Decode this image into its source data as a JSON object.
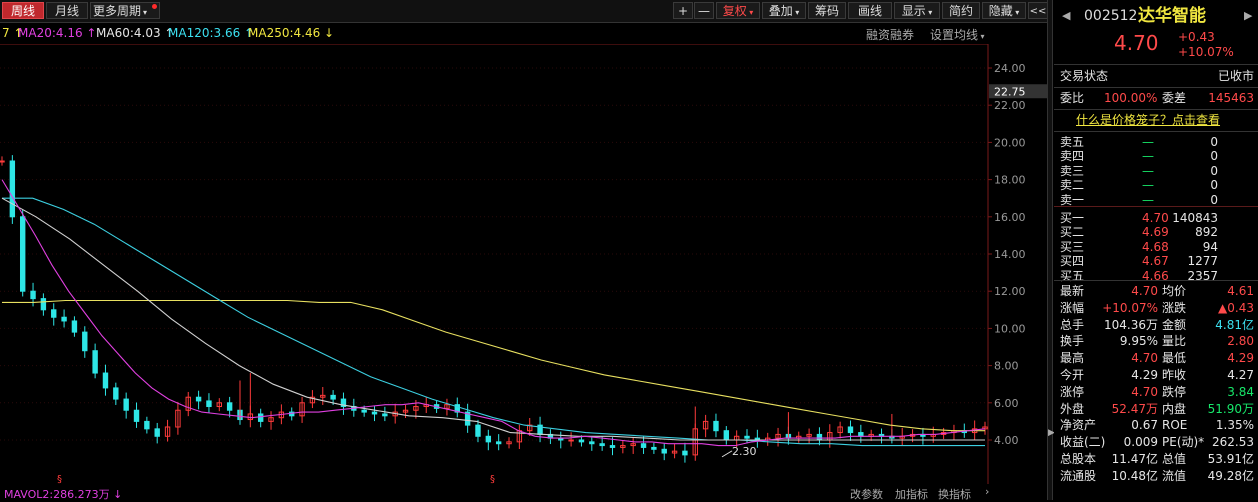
{
  "toolbar": {
    "tabs": [
      {
        "label": "周线",
        "active": true
      },
      {
        "label": "月线",
        "active": false
      },
      {
        "label": "更多周期",
        "active": false
      }
    ],
    "buttons": [
      "+",
      "—",
      "复权",
      "叠加",
      "筹码",
      "画线",
      "显示",
      "简约",
      "隐藏"
    ],
    "collapse": "<<"
  },
  "ma_legend": [
    {
      "label": "7 ↑",
      "color": "#f0e640"
    },
    {
      "label": "MA20:4.16 ↑",
      "color": "#e040e0"
    },
    {
      "label": "MA60:4.03 ↑",
      "color": "#e6e6e6"
    },
    {
      "label": "MA120:3.66 ↑",
      "color": "#3ce0f0"
    },
    {
      "label": "MA250:4.46 ↓",
      "color": "#f0e640"
    }
  ],
  "ma_links": [
    "融资融券",
    "设置均线"
  ],
  "chart_data": {
    "type": "candlestick",
    "y_ticks": [
      4.0,
      6.0,
      8.0,
      10.0,
      12.0,
      14.0,
      16.0,
      18.0,
      20.0,
      22.0,
      24.0
    ],
    "y_tick_labels": [
      "4.00",
      "6.00",
      "8.00",
      "10.00",
      "12.00",
      "14.00",
      "16.00",
      "18.00",
      "20.00",
      "22.00",
      "24.00"
    ],
    "ylim": [
      3.0,
      25.0
    ],
    "current_marker": "22.75",
    "low_annotation": {
      "label": "2.30",
      "value": 2.3
    },
    "series": {
      "price": [
        19.0,
        16.0,
        12.0,
        11.6,
        11.0,
        10.6,
        10.4,
        9.8,
        8.8,
        7.6,
        6.8,
        6.2,
        5.6,
        5.0,
        4.6,
        4.2,
        4.7,
        5.6,
        6.3,
        6.1,
        5.8,
        6.0,
        5.6,
        5.1,
        5.4,
        5.0,
        5.2,
        5.5,
        5.3,
        6.0,
        6.3,
        6.4,
        6.2,
        5.8,
        5.6,
        5.5,
        5.4,
        5.3,
        5.5,
        5.6,
        5.8,
        5.9,
        5.7,
        5.9,
        5.5,
        4.8,
        4.2,
        3.9,
        3.8,
        3.9,
        4.5,
        4.8,
        4.3,
        4.1,
        4.0,
        4.0,
        3.9,
        3.8,
        3.7,
        3.6,
        3.7,
        3.8,
        3.6,
        3.5,
        3.3,
        3.4,
        3.2,
        4.6,
        5.0,
        4.5,
        4.0,
        4.2,
        4.1,
        4.0,
        4.1,
        4.3,
        4.1,
        4.2,
        4.3,
        4.0,
        4.4,
        4.7,
        4.4,
        4.2,
        4.3,
        4.2,
        4.1,
        4.2,
        4.3,
        4.2,
        4.3,
        4.4,
        4.5,
        4.4,
        4.6,
        4.7
      ],
      "ma20": [
        18.0,
        16.5,
        15.0,
        13.4,
        12.0,
        10.8,
        9.6,
        8.6,
        7.6,
        6.8,
        6.2,
        5.8,
        5.5,
        5.4,
        5.3,
        5.2,
        5.3,
        5.4,
        5.5,
        5.5,
        5.6,
        5.7,
        5.8,
        5.9,
        5.9,
        6.0,
        5.8,
        5.6,
        5.4,
        5.2,
        5.0,
        4.5,
        4.2,
        4.1,
        4.1,
        4.2,
        4.1,
        4.0,
        3.9,
        3.9,
        3.8,
        3.8,
        3.8,
        3.7,
        3.7,
        3.9,
        4.0,
        4.1,
        4.1,
        4.1,
        4.1,
        4.2,
        4.2,
        4.2,
        4.2,
        4.3,
        4.3,
        4.4,
        4.5,
        4.6
      ],
      "ma60": [
        17.0,
        16.0,
        14.8,
        13.4,
        12.0,
        10.5,
        9.2,
        8.0,
        7.0,
        6.3,
        5.9,
        5.6,
        5.3,
        5.2,
        5.0,
        4.4,
        4.3,
        4.2,
        4.2,
        4.1,
        4.0,
        4.0,
        4.0,
        4.0,
        4.0,
        4.0,
        4.0,
        4.0,
        4.0,
        4.0
      ],
      "ma120": [
        17.0,
        17.0,
        16.4,
        15.6,
        14.6,
        13.6,
        12.6,
        11.6,
        10.6,
        9.8,
        9.0,
        8.2,
        7.4,
        6.8,
        6.2,
        5.7,
        5.2,
        4.8,
        4.6,
        4.4,
        4.3,
        4.2,
        4.1,
        4.0,
        4.0,
        3.9,
        3.8,
        3.8,
        3.7,
        3.7,
        3.7,
        3.7,
        3.7
      ],
      "ma250": [
        11.4,
        11.4,
        11.5,
        11.5,
        11.5,
        11.5,
        11.5,
        11.5,
        11.5,
        11.5,
        11.4,
        11.4,
        11.0,
        10.4,
        9.8,
        9.3,
        8.8,
        8.3,
        7.9,
        7.5,
        7.2,
        6.9,
        6.6,
        6.3,
        6.0,
        5.7,
        5.4,
        5.1,
        4.8,
        4.6,
        4.5,
        4.5
      ]
    },
    "spikes": [
      {
        "i": 23,
        "value": 7.2
      },
      {
        "i": 24,
        "value": 7.6
      },
      {
        "i": 67,
        "value": 5.8
      },
      {
        "i": 76,
        "value": 5.5
      },
      {
        "i": 86,
        "value": 5.4
      }
    ]
  },
  "chart_links": [
    "改参数",
    "加指标",
    "换指标"
  ],
  "vol_legend": {
    "label": "MAVOL2:286.273万 ↓",
    "color": "#e040e0"
  },
  "panel": {
    "code": "002512",
    "name": "达华智能",
    "price": "4.70",
    "change": "+0.43",
    "change_pct": "+10.07%",
    "status_label": "交易状态",
    "status_value": "已收市",
    "weibi_label": "委比",
    "weibi_value": "100.00%",
    "weicha_label": "委差",
    "weicha_value": "145463",
    "cage_link": "什么是价格笼子？点击查看",
    "asks": [
      {
        "label": "卖五",
        "price": "—",
        "vol": "0"
      },
      {
        "label": "卖四",
        "price": "—",
        "vol": "0"
      },
      {
        "label": "卖三",
        "price": "—",
        "vol": "0"
      },
      {
        "label": "卖二",
        "price": "—",
        "vol": "0"
      },
      {
        "label": "卖一",
        "price": "—",
        "vol": "0"
      }
    ],
    "bids": [
      {
        "label": "买一",
        "price": "4.70",
        "vol": "140843"
      },
      {
        "label": "买二",
        "price": "4.69",
        "vol": "892"
      },
      {
        "label": "买三",
        "price": "4.68",
        "vol": "94"
      },
      {
        "label": "买四",
        "price": "4.67",
        "vol": "1277"
      },
      {
        "label": "买五",
        "price": "4.66",
        "vol": "2357"
      }
    ],
    "stats": [
      [
        "最新",
        "4.70",
        "pr",
        "均价",
        "4.61",
        "pr"
      ],
      [
        "涨幅",
        "+10.07%",
        "pr",
        "涨跌",
        "▲0.43",
        "pr"
      ],
      [
        "总手",
        "104.36万",
        "pw",
        "金额",
        "4.81亿",
        "pc"
      ],
      [
        "换手",
        "9.95%",
        "pw",
        "量比",
        "2.80",
        "pr"
      ],
      [
        "最高",
        "4.70",
        "pr",
        "最低",
        "4.29",
        "pr"
      ],
      [
        "今开",
        "4.29",
        "pw",
        "昨收",
        "4.27",
        "pw"
      ],
      [
        "涨停",
        "4.70",
        "pr",
        "跌停",
        "3.84",
        "pg"
      ],
      [
        "外盘",
        "52.47万",
        "pr",
        "内盘",
        "51.90万",
        "pg"
      ],
      [
        "净资产",
        "0.67",
        "pw",
        "ROE",
        "1.35%",
        "pw"
      ],
      [
        "收益(二)",
        "0.009",
        "pw",
        "PE(动)*",
        "262.53",
        "pw"
      ],
      [
        "总股本",
        "11.47亿",
        "pw",
        "总值",
        "53.91亿",
        "pw"
      ],
      [
        "流通股",
        "10.48亿",
        "pw",
        "流值",
        "49.28亿",
        "pw"
      ]
    ]
  }
}
